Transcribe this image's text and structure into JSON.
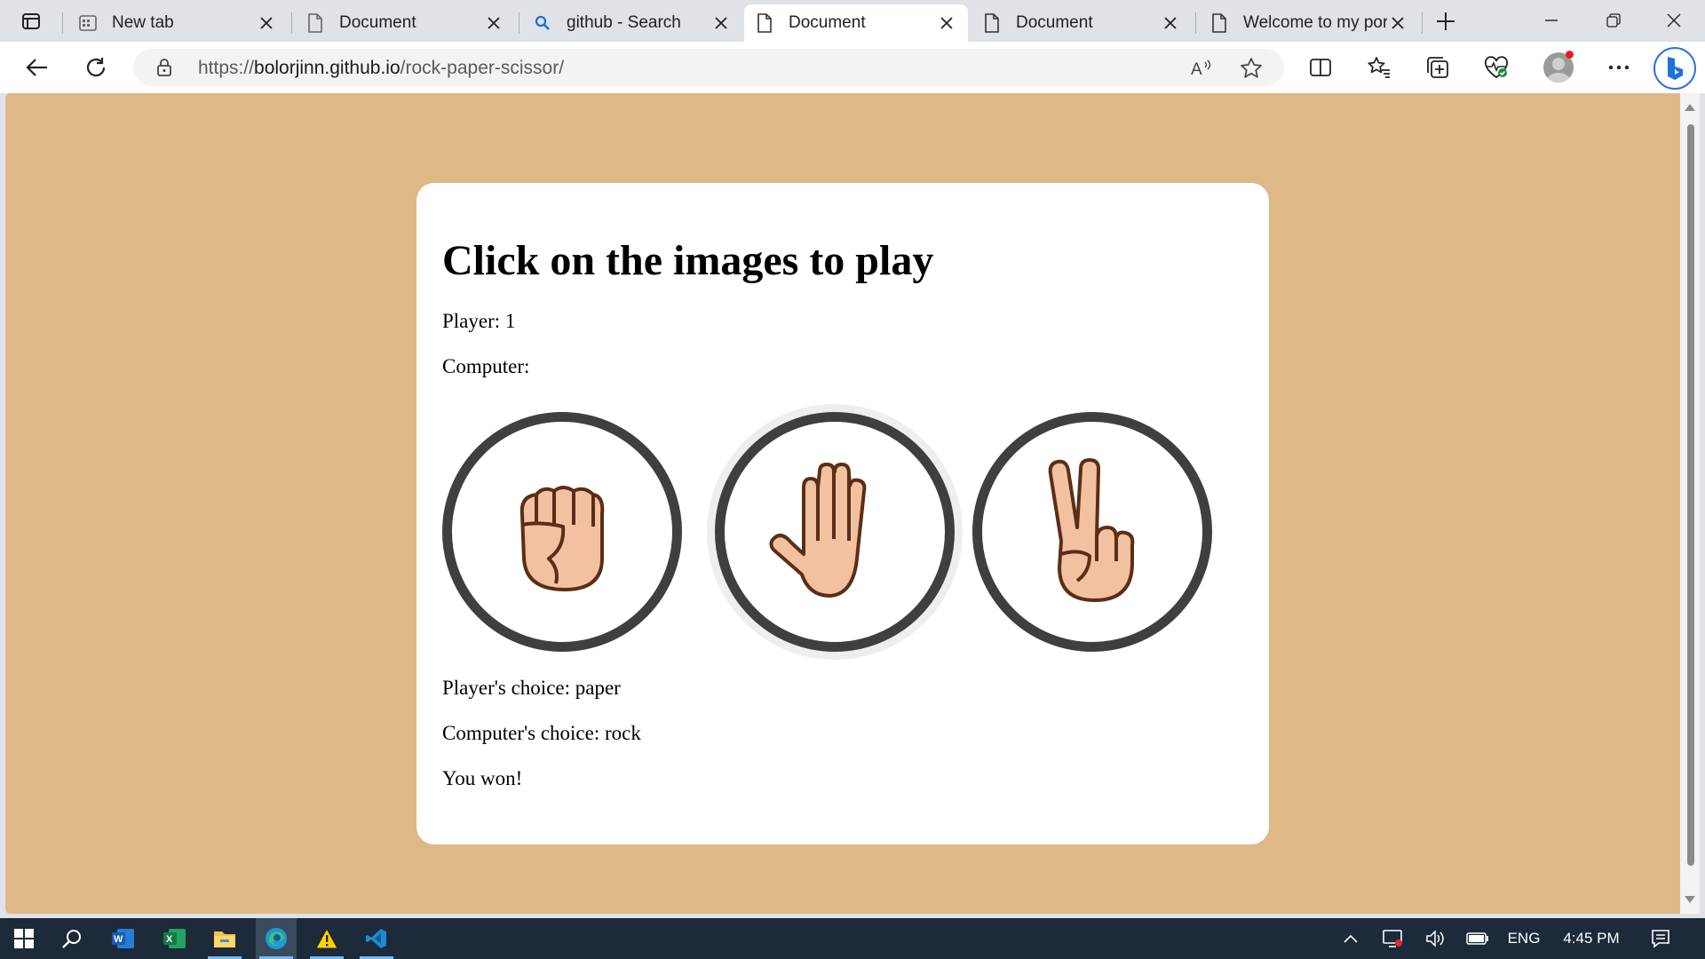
{
  "browser": {
    "tabs": [
      {
        "title": "New tab",
        "icon": "new-tab-page-icon",
        "active": false
      },
      {
        "title": "Document",
        "icon": "document-icon",
        "active": false
      },
      {
        "title": "github - Search",
        "icon": "search-icon",
        "active": false
      },
      {
        "title": "Document",
        "icon": "document-icon",
        "active": true
      },
      {
        "title": "Document",
        "icon": "document-icon",
        "active": false
      },
      {
        "title": "Welcome to my por",
        "icon": "document-icon",
        "active": false
      }
    ],
    "url_scheme": "https://",
    "url_host": "bolorjinn.github.io",
    "url_path": "/rock-paper-scissor/"
  },
  "page": {
    "background_color": "#deb887",
    "heading": "Click on the images to play",
    "player_label": "Player: 1",
    "computer_label": "Computer:",
    "choices": [
      {
        "name": "rock",
        "icon": "rock-fist-icon",
        "selected": false
      },
      {
        "name": "paper",
        "icon": "paper-open-hand-icon",
        "selected": true
      },
      {
        "name": "scissors",
        "icon": "scissors-peace-hand-icon",
        "selected": false
      }
    ],
    "player_choice": "Player's choice: paper",
    "computer_choice": "Computer's choice: rock",
    "result": "You won!"
  },
  "taskbar": {
    "apps": [
      "windows-start-icon",
      "search-icon",
      "word-icon",
      "excel-icon",
      "file-explorer-icon",
      "edge-icon",
      "warning-icon",
      "vscode-icon"
    ],
    "language": "ENG",
    "time": "4:45 PM"
  }
}
